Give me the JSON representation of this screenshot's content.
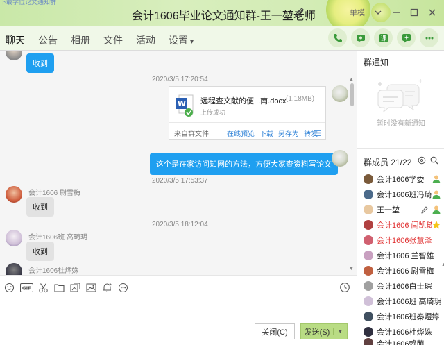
{
  "titlebar": {
    "top_left_text": "下载学位论文通知群",
    "title": "会计1606毕业论文通知群-王一堃老师",
    "mode_label": "单模",
    "win_controls": [
      "chevron-down-icon",
      "minimize-icon",
      "maximize-icon",
      "close-icon"
    ]
  },
  "nav": {
    "tabs": [
      "聊天",
      "公告",
      "相册",
      "文件",
      "活动",
      "设置"
    ],
    "active_tab": "聊天",
    "action_icons": [
      "phone-icon",
      "video-call-icon",
      "class-icon",
      "add-app-icon",
      "more-icon"
    ]
  },
  "messages": {
    "msg1_text": "收到",
    "ts1": "2020/3/5 17:20:54",
    "file": {
      "name": "远程查文献的便...南.docx",
      "size": "(1.18MB)",
      "status": "上传成功",
      "source": "来自群文件",
      "actions": [
        "在线预览",
        "下载",
        "另存为",
        "转发"
      ]
    },
    "msg_self_text": "这个是在家访问知网的方法，方便大家查资料写论文",
    "ts2": "2020/3/5 17:53:37",
    "sender2": "会计1606 尉雪梅",
    "msg2_text": "收到",
    "ts3": "2020/3/5 18:12:04",
    "sender3": "会计1606班 高琦玥",
    "msg3_text": "收到",
    "sender4": "会计1606杜烨姝"
  },
  "input": {
    "tools": [
      "emoji-icon",
      "gif-icon",
      "scissors-icon",
      "folder-icon",
      "image-edit-icon",
      "picture-icon",
      "bell-icon",
      "more-dots-icon"
    ],
    "close_label": "关闭(C)",
    "send_label": "发送(S)"
  },
  "panel": {
    "notice_title": "群通知",
    "notice_empty": "暂时没有新通知",
    "members_title": "群成员 21/22",
    "members": [
      {
        "name": "会计1606学委",
        "color": "#7a5a3a",
        "red": false,
        "badge": "admin"
      },
      {
        "name": "会计1606班冯琦",
        "color": "#4b6a8a",
        "red": false,
        "badge": "admin"
      },
      {
        "name": "王一堃",
        "color": "#e8c8a0",
        "red": false,
        "badge": "owner"
      },
      {
        "name": "会计1606 闫凯琦",
        "color": "#b04040",
        "red": true,
        "badge": "star"
      },
      {
        "name": "会计1606张慧泽",
        "color": "#d06070",
        "red": true,
        "badge": ""
      },
      {
        "name": "会计1606 兰智雄",
        "color": "#c8a0c0",
        "red": false,
        "badge": ""
      },
      {
        "name": "会计1606 尉雪梅",
        "color": "#c06040",
        "red": false,
        "badge": ""
      },
      {
        "name": "会计1606白士琛",
        "color": "#a0a0a0",
        "red": false,
        "badge": ""
      },
      {
        "name": "会计1606班 高琦玥",
        "color": "#d0c0d8",
        "red": false,
        "badge": ""
      },
      {
        "name": "会计1606班秦煜婷",
        "color": "#405060",
        "red": false,
        "badge": ""
      },
      {
        "name": "会计1606杜烨姝",
        "color": "#303040",
        "red": false,
        "badge": ""
      },
      {
        "name": "会计1606赖萌",
        "color": "#604040",
        "red": false,
        "badge": ""
      }
    ]
  },
  "colors": {
    "accent_blue": "#1f9ff0",
    "title_green": "#d3ecb5",
    "send_green": "#b9dc84",
    "red_name": "#e03030"
  }
}
